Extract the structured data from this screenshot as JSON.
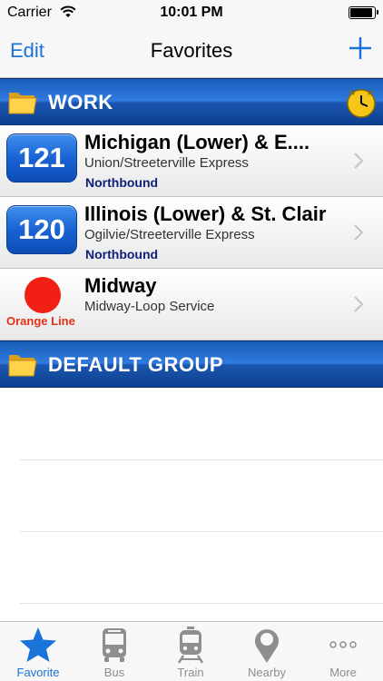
{
  "status_bar": {
    "carrier": "Carrier",
    "time": "10:01 PM",
    "battery_level": 0.95
  },
  "nav": {
    "edit_label": "Edit",
    "title": "Favorites"
  },
  "groups": [
    {
      "label": "WORK",
      "items": [
        {
          "route": "121",
          "title": "Michigan (Lower) & E....",
          "subtitle": "Union/Streeterville Express",
          "direction": "Northbound"
        },
        {
          "route": "120",
          "title": "Illinois (Lower) & St. Clair",
          "subtitle": "Ogilvie/Streeterville Express",
          "direction": "Northbound"
        },
        {
          "line": "Orange Line",
          "line_color": "#f21f14",
          "title": "Midway",
          "subtitle": "Midway-Loop Service"
        }
      ]
    },
    {
      "label": "DEFAULT GROUP",
      "items": []
    }
  ],
  "tabs": [
    {
      "label": "Favorite",
      "icon": "star-icon",
      "active": true
    },
    {
      "label": "Bus",
      "icon": "bus-icon",
      "active": false
    },
    {
      "label": "Train",
      "icon": "train-icon",
      "active": false
    },
    {
      "label": "Nearby",
      "icon": "map-pin-icon",
      "active": false
    },
    {
      "label": "More",
      "icon": "more-dots-icon",
      "active": false
    }
  ],
  "colors": {
    "accent": "#1a73d9",
    "header_blue": "#1b56b0",
    "direction_navy": "#0e1f7a",
    "orange_line_label": "#e53019"
  }
}
